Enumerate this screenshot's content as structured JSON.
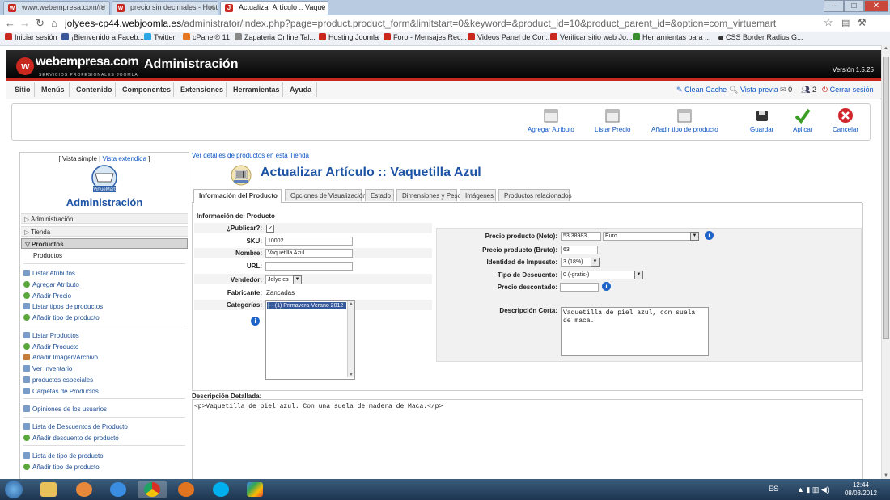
{
  "browser": {
    "tabs": [
      {
        "label": "www.webempresa.com/re"
      },
      {
        "label": "precio sin decimales - Host"
      },
      {
        "label": "Actualizar Artículo :: Vaque"
      }
    ],
    "url_host": "jolyees-cp44.webjoomla.es",
    "url_rest": "/administrator/index.php?page=product.product_form&limitstart=0&keyword=&product_id=10&product_parent_id=&option=com_virtuemart",
    "bookmarks": [
      {
        "label": "Iniciar sesión",
        "color": "#c8281e"
      },
      {
        "label": "¡Bienvenido a Faceb...",
        "color": "#3b5998"
      },
      {
        "label": "Twitter",
        "color": "#2aa9e0"
      },
      {
        "label": "cPanel® 11",
        "color": "#e87722"
      },
      {
        "label": "Zapateria Online Tal...",
        "color": "#888888"
      },
      {
        "label": "Hosting Joomla",
        "color": "#c8281e"
      },
      {
        "label": "Foro - Mensajes Rec...",
        "color": "#c8281e"
      },
      {
        "label": "Videos Panel de Con...",
        "color": "#c8281e"
      },
      {
        "label": "Verificar sitio web Jo...",
        "color": "#c8281e"
      },
      {
        "label": "Herramientas para ...",
        "color": "#3a8d2e"
      },
      {
        "label": "CSS Border Radius G...",
        "color": "#333333"
      }
    ]
  },
  "header": {
    "logo": "webempresa.com",
    "logo_sub": "SERVICIOS PROFESIONALES JOOMLA",
    "title": "Administración",
    "version": "Versión 1.5.25"
  },
  "menu": {
    "items": [
      "Sitio",
      "Menús",
      "Contenido",
      "Componentes",
      "Extensiones",
      "Herramientas",
      "Ayuda"
    ],
    "clean_cache": "Clean Cache",
    "preview": "Vista previa",
    "count1": "0",
    "count2": "2",
    "logout": "Cerrar sesión"
  },
  "toolbar": {
    "add_attribute": "Agregar Atributo",
    "list_price": "Listar Precio",
    "add_product_type": "Añadir tipo de producto",
    "save": "Guardar",
    "apply": "Aplicar",
    "cancel": "Cancelar"
  },
  "left": {
    "view_simple": "[ Vista simple |",
    "view_extended": "Vista extendida",
    "view_close": "]",
    "vm_logo_text": "VirtueMart",
    "title": "Administración",
    "sections": [
      "Administración",
      "Tienda",
      "Productos"
    ],
    "productos_sub": "Productos",
    "group1": [
      "Listar Atributos",
      "Agregar Atributo",
      "Añadir Precio",
      "Listar tipos de productos",
      "Añadir tipo de producto"
    ],
    "group2": [
      "Listar Productos",
      "Añadir Producto",
      "Añadir Imagen/Archivo",
      "Ver Inventario",
      "productos especiales",
      "Carpetas de Productos"
    ],
    "group3": [
      "Opiniones de los usuarios"
    ],
    "group4": [
      "Lista de Descuentos de Producto",
      "Añadir descuento de producto"
    ],
    "group5": [
      "Lista de tipo de producto",
      "Añadir tipo de producto"
    ]
  },
  "main": {
    "view_details": "Ver detalles de productos en esta Tienda",
    "title": "Actualizar Artículo :: Vaquetilla Azul",
    "tabs": [
      "Información del Producto",
      "Opciones de Visualización",
      "Estado",
      "Dimensiones y Peso",
      "Imágenes",
      "Productos relacionados"
    ],
    "section_title": "Información del Producto",
    "publish_label": "¿Publicar?:",
    "sku_label": "SKU:",
    "sku_value": "10002",
    "name_label": "Nombre:",
    "name_value": "Vaquetilla Azul",
    "url_label": "URL:",
    "url_value": "",
    "vendor_label": "Vendedor:",
    "vendor_value": "Jolye.es",
    "manufacturer_label": "Fabricante:",
    "manufacturer_value": "Zancadas",
    "categories_label": "Categorías:",
    "category_selected": "|---(1) Primavera-Verano 2012",
    "price_net_label": "Precio producto (Neto):",
    "price_net_value": "53.38983",
    "currency_value": "Euro",
    "price_gross_label": "Precio producto (Bruto):",
    "price_gross_value": "63",
    "tax_label": "Identidad de Impuesto:",
    "tax_value": "3 (18%)",
    "discount_type_label": "Tipo de Descuento:",
    "discount_type_value": "0 (-gratis-)",
    "discounted_price_label": "Precio descontado:",
    "discounted_price_value": "",
    "short_desc_label": "Descripción Corta:",
    "short_desc_value": "Vaquetilla de piel azul, con suela de maca.",
    "detailed_desc_label": "Descripción Detallada:",
    "detailed_desc_value": "<p>Vaquetilla de piel azul. Con una suela de madera de Maca.</p>"
  },
  "taskbar": {
    "lang": "ES",
    "time": "12:44",
    "date": "08/03/2012"
  }
}
